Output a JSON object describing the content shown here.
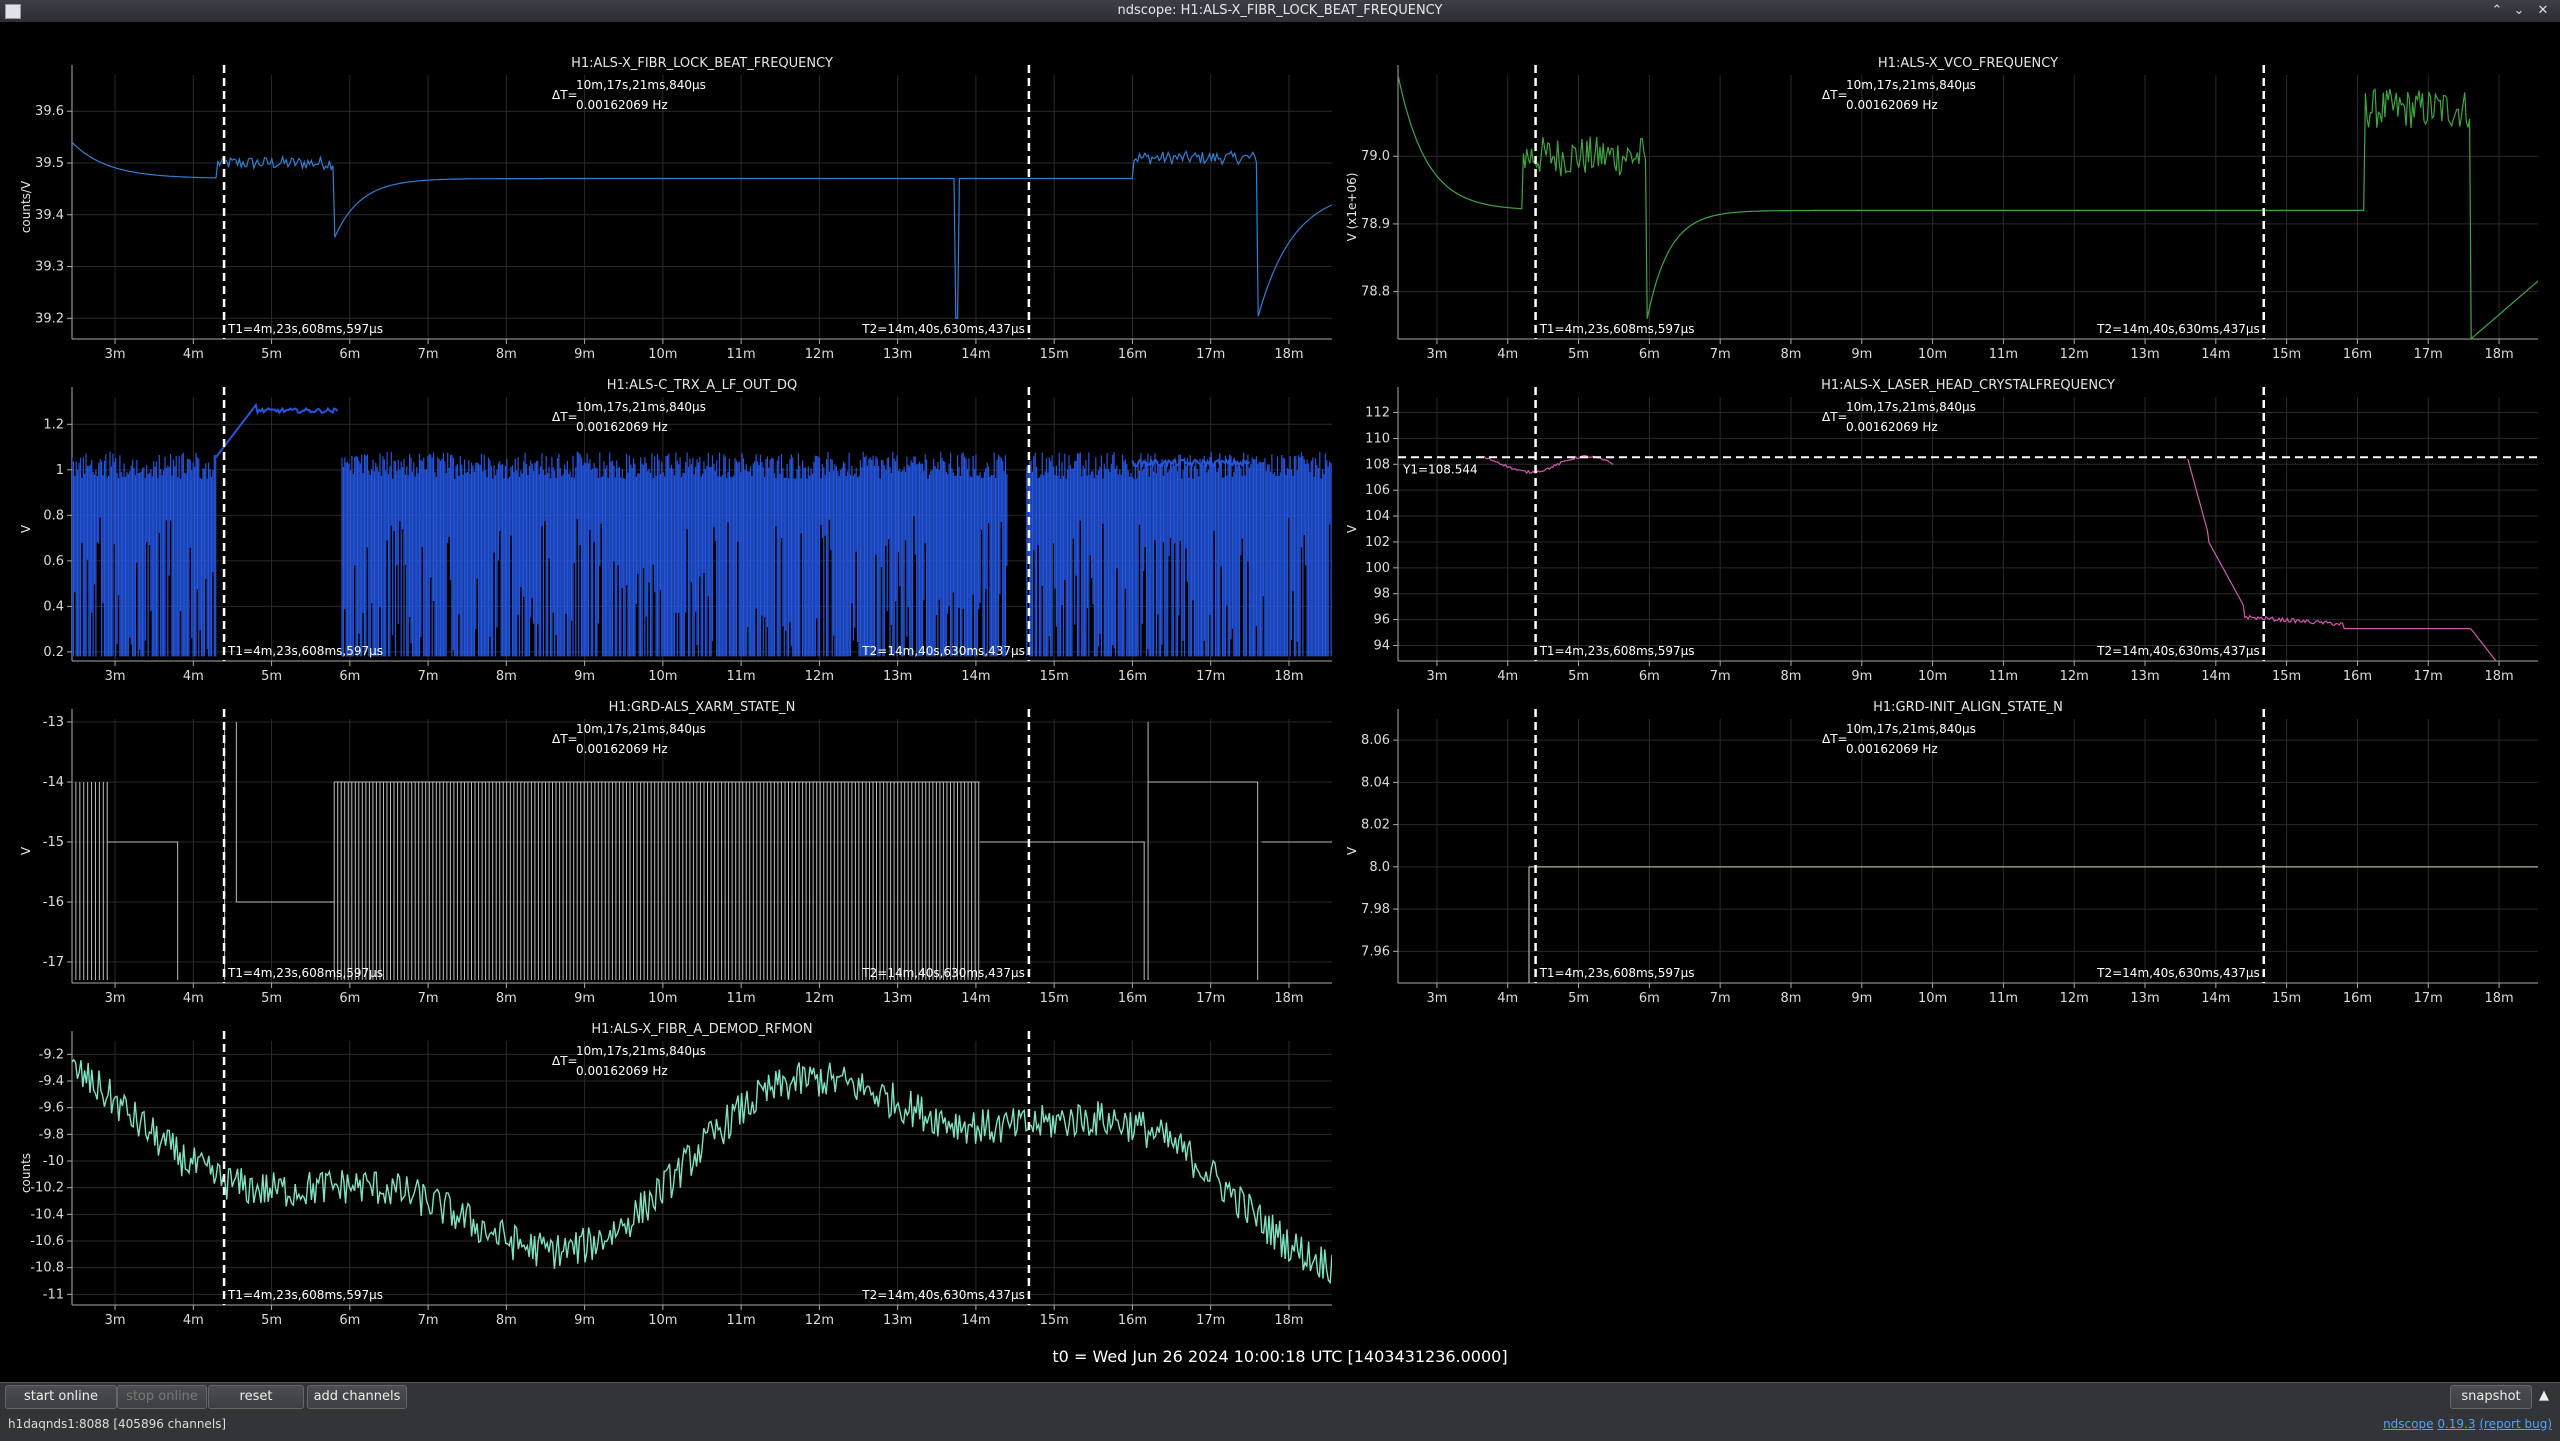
{
  "window": {
    "title": "ndscope: H1:ALS-X_FIBR_LOCK_BEAT_FREQUENCY",
    "controls": [
      "⌃",
      "⌄",
      "✕"
    ]
  },
  "cursors": {
    "t1_label": "T1=4m,23s,608ms,597μs",
    "t2_label": "T2=14m,40s,630ms,437μs",
    "delta_label": "ΔT=",
    "delta_time": "10m,17s,21ms,840μs",
    "delta_freq": "0.00162069 Hz",
    "t1_min": 4.393,
    "t2_min": 14.677
  },
  "x_axis": {
    "range_min": [
      2.45,
      18.55
    ],
    "ticks": [
      {
        "v": 3,
        "label": "3m"
      },
      {
        "v": 4,
        "label": "4m"
      },
      {
        "v": 5,
        "label": "5m"
      },
      {
        "v": 6,
        "label": "6m"
      },
      {
        "v": 7,
        "label": "7m"
      },
      {
        "v": 8,
        "label": "8m"
      },
      {
        "v": 9,
        "label": "9m"
      },
      {
        "v": 10,
        "label": "10m"
      },
      {
        "v": 11,
        "label": "11m"
      },
      {
        "v": 12,
        "label": "12m"
      },
      {
        "v": 13,
        "label": "13m"
      },
      {
        "v": 14,
        "label": "14m"
      },
      {
        "v": 15,
        "label": "15m"
      },
      {
        "v": 16,
        "label": "16m"
      },
      {
        "v": 17,
        "label": "17m"
      },
      {
        "v": 18,
        "label": "18m"
      }
    ]
  },
  "plots": [
    {
      "id": "p1",
      "title": "H1:ALS-X_FIBR_LOCK_BEAT_FREQUENCY",
      "ylabel": "counts/V",
      "ylim": [
        39.16,
        39.67
      ],
      "yticks": [
        "39.2",
        "39.3",
        "39.4",
        "39.5",
        "39.6"
      ],
      "ytickvals": [
        39.2,
        39.3,
        39.4,
        39.5,
        39.6
      ],
      "color": "#2f7fd6"
    },
    {
      "id": "p2",
      "title": "H1:ALS-X_VCO_FREQUENCY",
      "ylabel": "V (x1e+06)",
      "ylim": [
        78.73,
        79.12
      ],
      "yticks": [
        "78.8",
        "78.9",
        "79.0"
      ],
      "ytickvals": [
        78.8,
        78.9,
        79.0
      ],
      "color": "#3fa63f"
    },
    {
      "id": "p3",
      "title": "H1:ALS-C_TRX_A_LF_OUT_DQ",
      "ylabel": "V",
      "ylim": [
        0.16,
        1.32
      ],
      "yticks": [
        "0.2",
        "0.4",
        "0.6",
        "0.8",
        "1",
        "1.2"
      ],
      "ytickvals": [
        0.2,
        0.4,
        0.6,
        0.8,
        1.0,
        1.2
      ],
      "color": "#2456e0"
    },
    {
      "id": "p4",
      "title": "H1:ALS-X_LASER_HEAD_CRYSTALFREQUENCY",
      "ylabel": "V",
      "ylim": [
        92.8,
        113.2
      ],
      "yticks": [
        "94",
        "96",
        "98",
        "100",
        "102",
        "104",
        "106",
        "108",
        "110",
        "112"
      ],
      "ytickvals": [
        94,
        96,
        98,
        100,
        102,
        104,
        106,
        108,
        110,
        112
      ],
      "color": "#d15ab0",
      "y1_label": "Y1=108.544",
      "y1_value": 108.544
    },
    {
      "id": "p5",
      "title": "H1:GRD-ALS_XARM_STATE_N",
      "ylabel": "V",
      "ylim": [
        -17.35,
        -12.95
      ],
      "yticks": [
        "-17",
        "-16",
        "-15",
        "-14",
        "-13"
      ],
      "ytickvals": [
        -17,
        -16,
        -15,
        -14,
        -13
      ],
      "color": "#bdbdbd"
    },
    {
      "id": "p6",
      "title": "H1:GRD-INIT_ALIGN_STATE_N",
      "ylabel": "V",
      "ylim": [
        7.945,
        8.07
      ],
      "yticks": [
        "7.96",
        "7.98",
        "8.0",
        "8.02",
        "8.04",
        "8.06"
      ],
      "ytickvals": [
        7.96,
        7.98,
        8.0,
        8.02,
        8.04,
        8.06
      ],
      "color": "#d9d9a0"
    },
    {
      "id": "p7",
      "title": "H1:ALS-X_FIBR_A_DEMOD_RFMON",
      "ylabel": "counts",
      "ylim": [
        -11.08,
        -9.1
      ],
      "yticks": [
        "-11",
        "-10.8",
        "-10.6",
        "-10.4",
        "-10.2",
        "-10",
        "-9.8",
        "-9.6",
        "-9.4",
        "-9.2"
      ],
      "ytickvals": [
        -11,
        -10.8,
        -10.6,
        -10.4,
        -10.2,
        -10,
        -9.8,
        -9.6,
        -9.4,
        -9.2
      ],
      "color": "#7fe3c0"
    }
  ],
  "t0_label": "t0 = Wed Jun 26 2024 10:00:18 UTC [1403431236.0000]",
  "toolbar": {
    "start_online": "start online",
    "stop_online": "stop online",
    "reset": "reset",
    "add_channels": "add channels",
    "snapshot": "snapshot",
    "expand": "▲"
  },
  "status": {
    "server": "h1daqnds1:8088",
    "channels": "[405896 channels]",
    "app": "ndscope",
    "version": "0.19.3",
    "report": "(report bug)"
  }
}
